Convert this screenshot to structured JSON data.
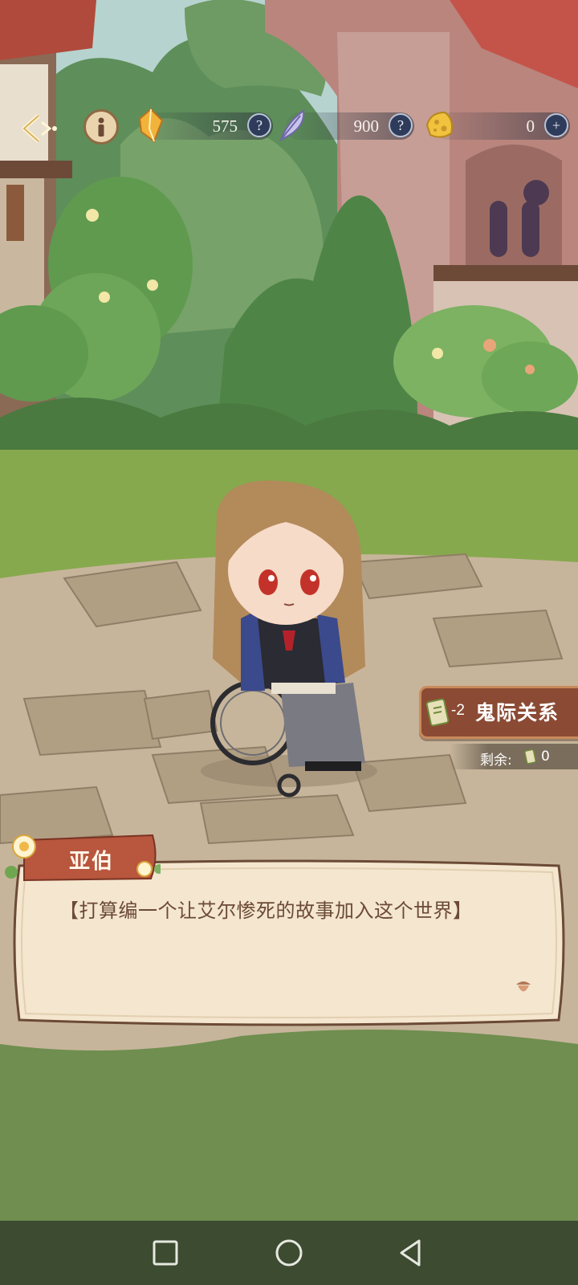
{
  "resources": {
    "crystal": {
      "value": "575",
      "icon": "crystal-icon",
      "help": "?"
    },
    "feather": {
      "value": "900",
      "icon": "feather-icon",
      "help": "?"
    },
    "cheese": {
      "value": "0",
      "icon": "cheese-icon",
      "add": "+"
    }
  },
  "relation": {
    "cost": "-2",
    "label": "鬼际关系"
  },
  "remaining": {
    "label": "剩余:",
    "count": "0"
  },
  "dialogue": {
    "speaker": "亚伯",
    "text": "【打算编一个让艾尔惨死的故事加入这个世界】"
  },
  "colors": {
    "accent": "#8b4a34",
    "dialog_bg": "#f4e6cf",
    "dialog_border": "#6b4a36",
    "navbar": "#3d4b30"
  }
}
